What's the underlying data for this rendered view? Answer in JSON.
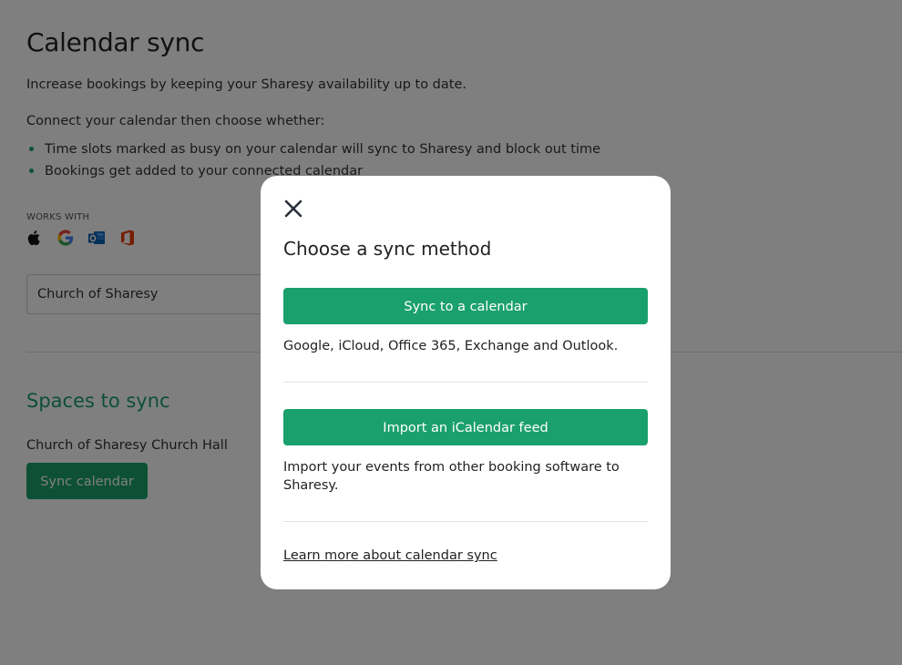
{
  "page": {
    "title": "Calendar sync",
    "intro": "Increase bookings by keeping your Sharesy availability up to date.",
    "connect_text": "Connect your calendar then choose whether:",
    "bullets": [
      "Time slots marked as busy on your calendar will sync to Sharesy and block out time",
      "Bookings get added to your connected calendar"
    ],
    "works_with_label": "WORKS WITH",
    "works_with_icons": [
      "apple-icon",
      "google-icon",
      "outlook-icon",
      "office-icon"
    ],
    "org_select_value": "Church of Sharesy",
    "spaces_heading": "Spaces to sync",
    "space_name": "Church of Sharesy Church Hall",
    "sync_button_label": "Sync calendar"
  },
  "modal": {
    "title": "Choose a sync method",
    "close_icon": "close-icon",
    "option_sync": {
      "button_label": "Sync to a calendar",
      "description": "Google, iCloud, Office 365, Exchange and Outlook."
    },
    "option_import": {
      "button_label": "Import an iCalendar feed",
      "description": "Import your events from other booking software to Sharesy."
    },
    "learn_more_link": "Learn more about calendar sync"
  },
  "colors": {
    "accent": "#1aa06d",
    "overlay": "rgba(0,0,0,0.5)",
    "text": "#222222"
  }
}
